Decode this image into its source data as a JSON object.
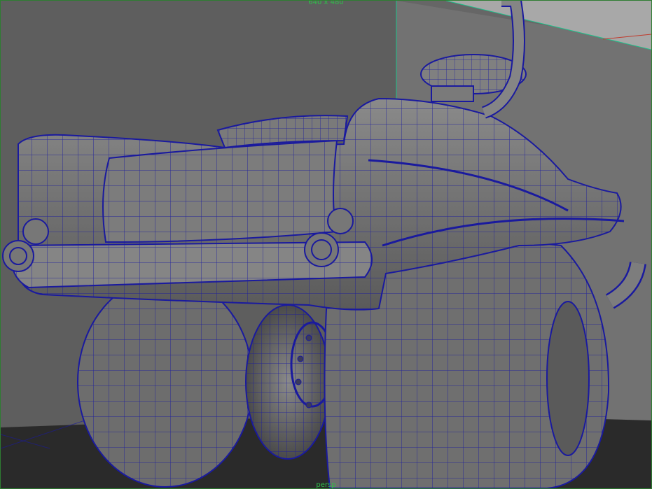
{
  "viewport": {
    "resolution_gate_label": "640 x 480",
    "bottom_label": "persp"
  },
  "scene": {
    "object": "monster-car-model",
    "display_mode": "wireframe-on-shaded",
    "colors": {
      "background_wall": "#6b6b6b",
      "floor": "#2a2a2a",
      "wireframe": "#1a1a9e",
      "shaded_surface": "#7a7a7a",
      "resolution_gate": "#1ec08a",
      "plane": "#a8a8a8"
    }
  }
}
